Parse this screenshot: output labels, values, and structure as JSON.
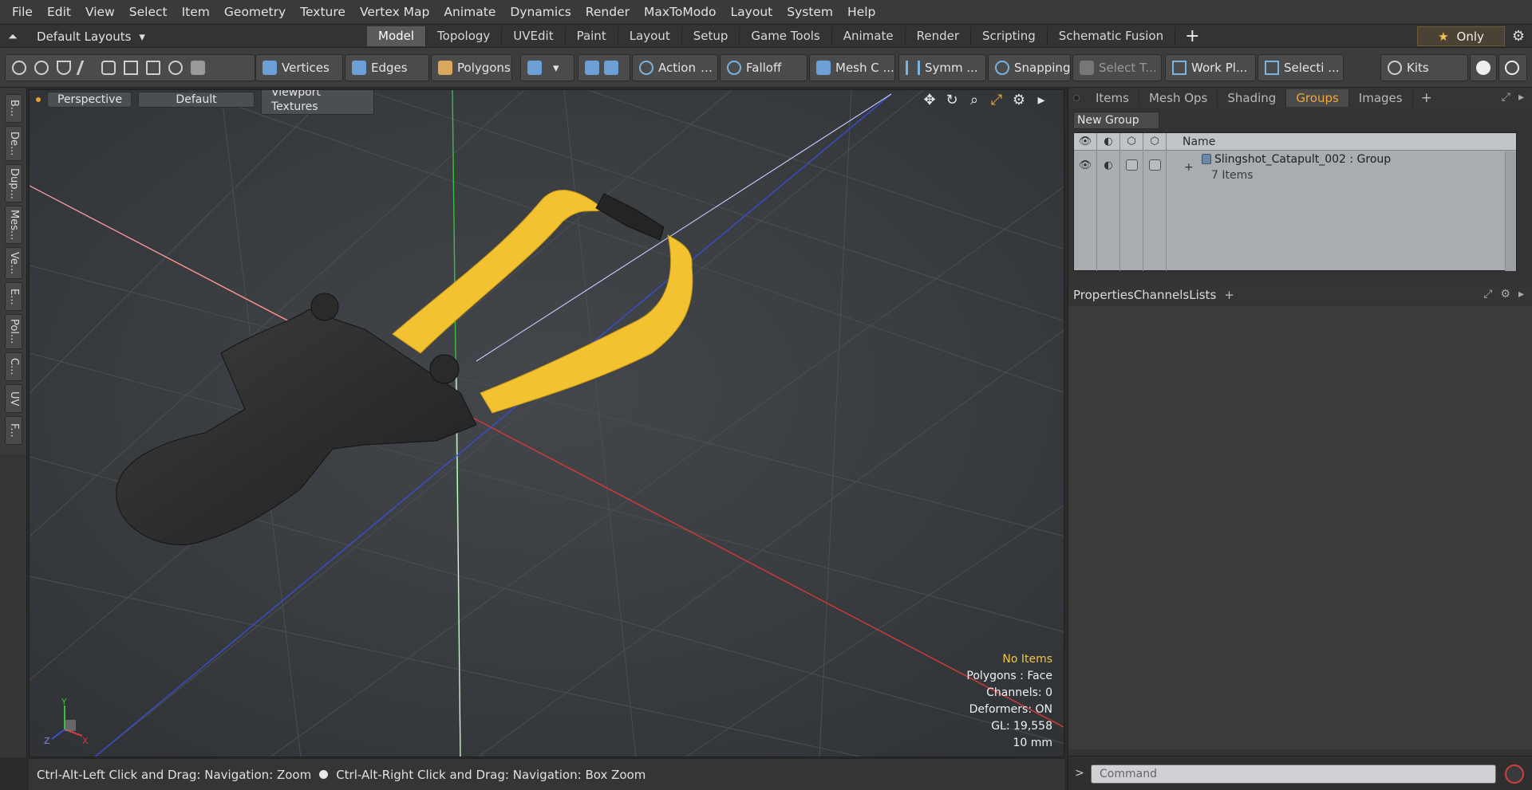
{
  "menu": [
    "File",
    "Edit",
    "View",
    "Select",
    "Item",
    "Geometry",
    "Texture",
    "Vertex Map",
    "Animate",
    "Dynamics",
    "Render",
    "MaxToModo",
    "Layout",
    "System",
    "Help"
  ],
  "layouts": {
    "label": "Default Layouts"
  },
  "tabs": [
    "Model",
    "Topology",
    "UVEdit",
    "Paint",
    "Layout",
    "Setup",
    "Game Tools",
    "Animate",
    "Render",
    "Scripting",
    "Schematic Fusion"
  ],
  "active_tab": "Model",
  "only_label": "Only",
  "toolbar": {
    "vertices": "Vertices",
    "edges": "Edges",
    "polygons": "Polygons",
    "action": "Action",
    "falloff": "Falloff",
    "mesh": "Mesh C ...",
    "symm": "Symm ...",
    "snapping": "Snapping",
    "select_t": "Select T...",
    "workpl": "Work Pl...",
    "selecti": "Selecti ...",
    "kits": "Kits"
  },
  "left_tabs": [
    "B...",
    "De...",
    "Dup...",
    "Mes...",
    "Ve...",
    "E...",
    "Pol...",
    "C...",
    "UV",
    "F..."
  ],
  "viewport": {
    "perspective": "Perspective",
    "shading": "Default",
    "textures": "Viewport Textures",
    "info": {
      "no_items": "No Items",
      "polygons": "Polygons : Face",
      "channels": "Channels: 0",
      "deformers": "Deformers: ON",
      "gl": "GL: 19,558",
      "unit": "10 mm"
    },
    "gizmo_labels": {
      "x": "X",
      "y": "Y",
      "z": "Z"
    }
  },
  "status": {
    "hint1": "Ctrl-Alt-Left Click and Drag: Navigation: Zoom",
    "hint2": "Ctrl-Alt-Right Click and Drag: Navigation: Box Zoom"
  },
  "right_tabs": [
    "Items",
    "Mesh Ops",
    "Shading",
    "Groups",
    "Images"
  ],
  "right_active": "Groups",
  "groups": {
    "new_group": "New Group",
    "name_header": "Name",
    "row": {
      "name": "Slingshot_Catapult_002 : Group",
      "count": "7 Items"
    }
  },
  "props_tabs": [
    "Properties",
    "Channels",
    "Lists"
  ],
  "props_active": "Properties",
  "command_placeholder": "Command",
  "colors": {
    "accent": "#f1a63a",
    "band": "#f2c230",
    "x_axis": "#d23a3a",
    "y_axis": "#3bbf3b",
    "z_axis": "#3a4fd8"
  }
}
